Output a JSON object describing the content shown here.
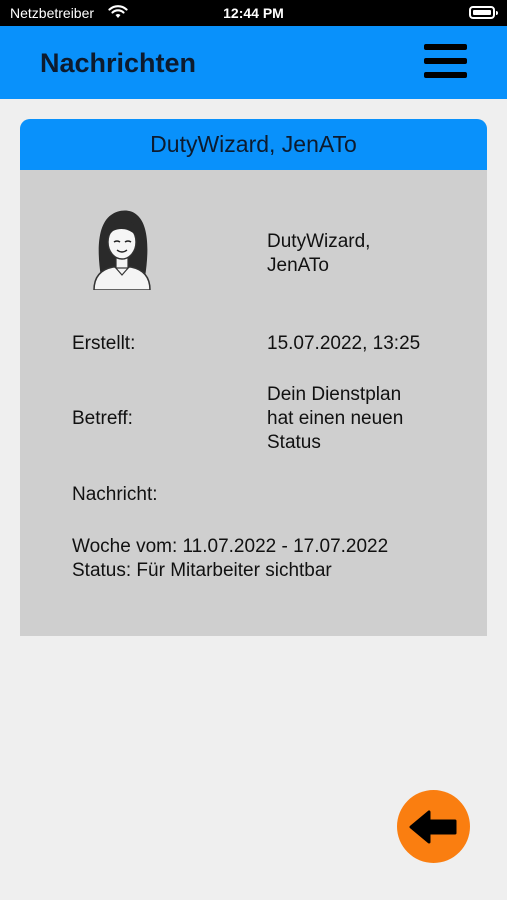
{
  "status_bar": {
    "carrier": "Netzbetreiber",
    "time": "12:44 PM",
    "icons": [
      "wifi-icon",
      "battery-icon"
    ]
  },
  "header": {
    "title": "Nachrichten",
    "menu_icon": "hamburger-menu-icon"
  },
  "message": {
    "title": "DutyWizard, JenATo",
    "sender_line1": "DutyWizard,",
    "sender_line2": "JenATo",
    "created_label": "Erstellt:",
    "created_value": "15.07.2022, 13:25",
    "subject_label": "Betreff:",
    "subject_line1": "Dein Dienstplan",
    "subject_line2": "hat einen neuen",
    "subject_line3": "Status",
    "message_label": "Nachricht:",
    "body_line1": "Woche vom: 11.07.2022 - 17.07.2022",
    "body_line2": "Status: Für Mitarbeiter sichtbar"
  },
  "back_button": {
    "icon": "arrow-left-icon"
  },
  "colors": {
    "accent_blue": "#0991fb",
    "card_gray": "#cfcfcf",
    "back_orange": "#fa7e10"
  }
}
